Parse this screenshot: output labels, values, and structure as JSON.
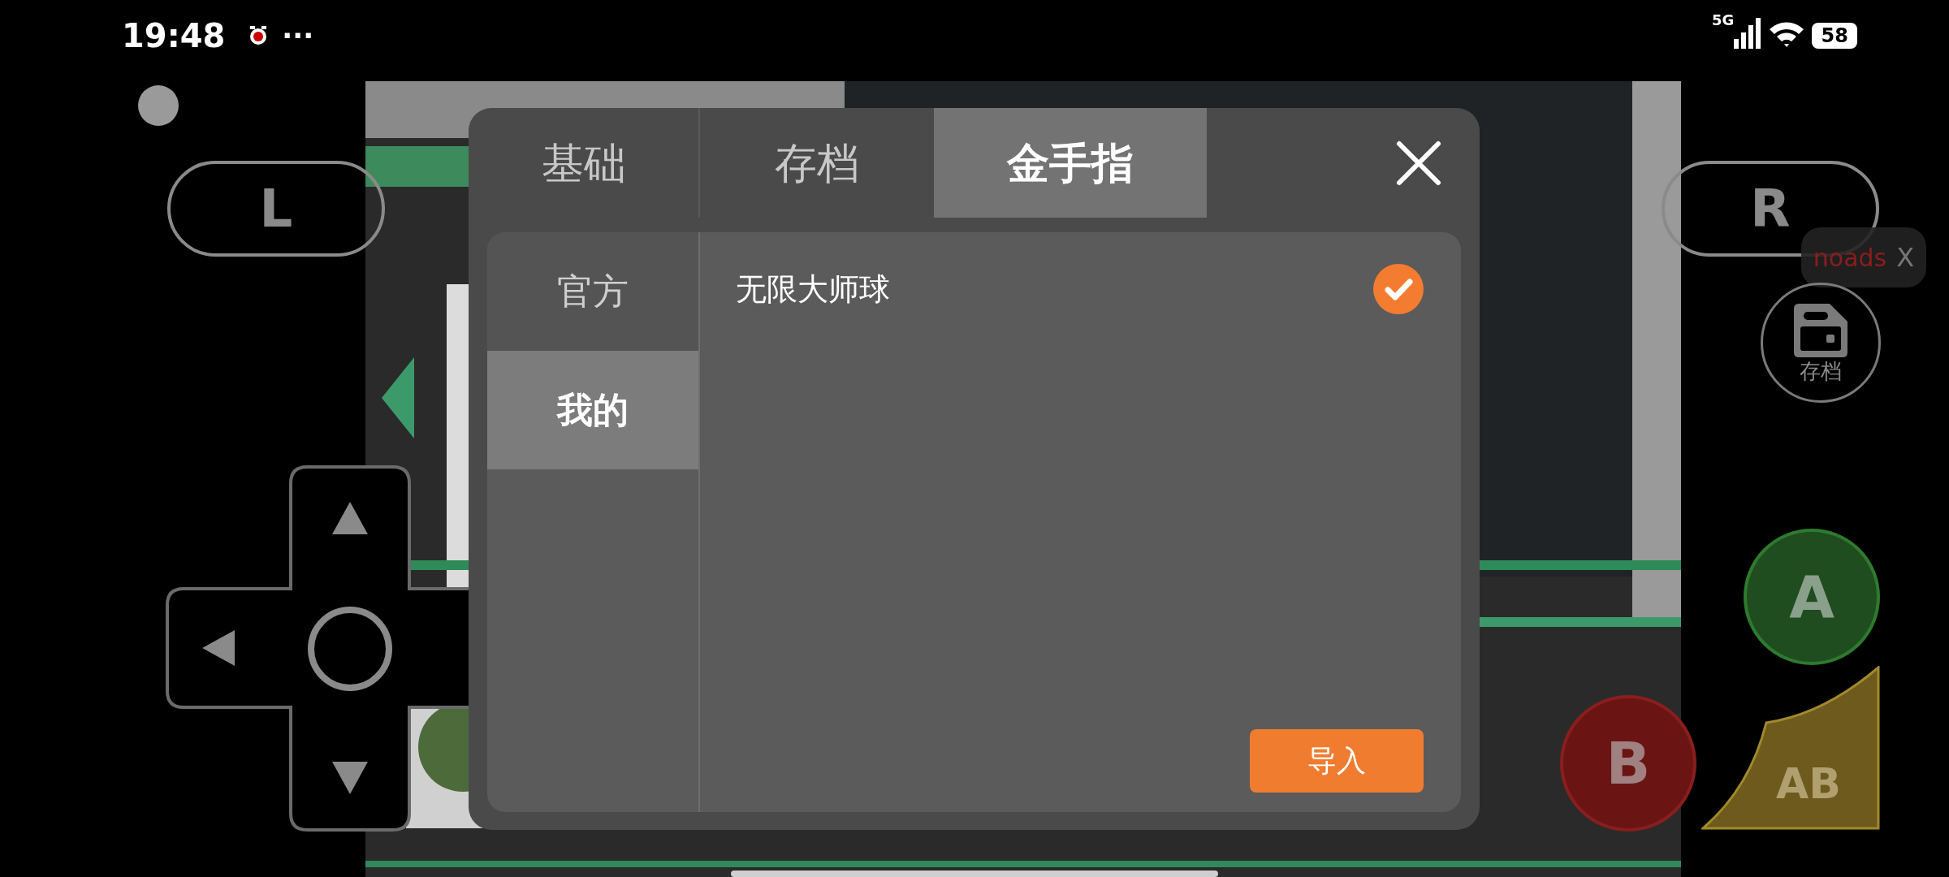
{
  "status_bar": {
    "time": "19:48",
    "more": "···",
    "network": "5G",
    "battery": "58"
  },
  "controls": {
    "l_button": "L",
    "r_button": "R",
    "a_button": "A",
    "b_button": "B",
    "ab_button": "AB",
    "save_button": "存档",
    "ad_banner": {
      "text": "noads",
      "close": "X"
    }
  },
  "dialog": {
    "tabs": [
      {
        "label": "基础",
        "selected": false
      },
      {
        "label": "存档",
        "selected": false
      },
      {
        "label": "金手指",
        "selected": true
      }
    ],
    "sidebar": [
      {
        "label": "官方",
        "selected": false
      },
      {
        "label": "我的",
        "selected": true
      }
    ],
    "cheats": [
      {
        "name": "无限大师球",
        "checked": true
      }
    ],
    "import_button": "导入"
  }
}
